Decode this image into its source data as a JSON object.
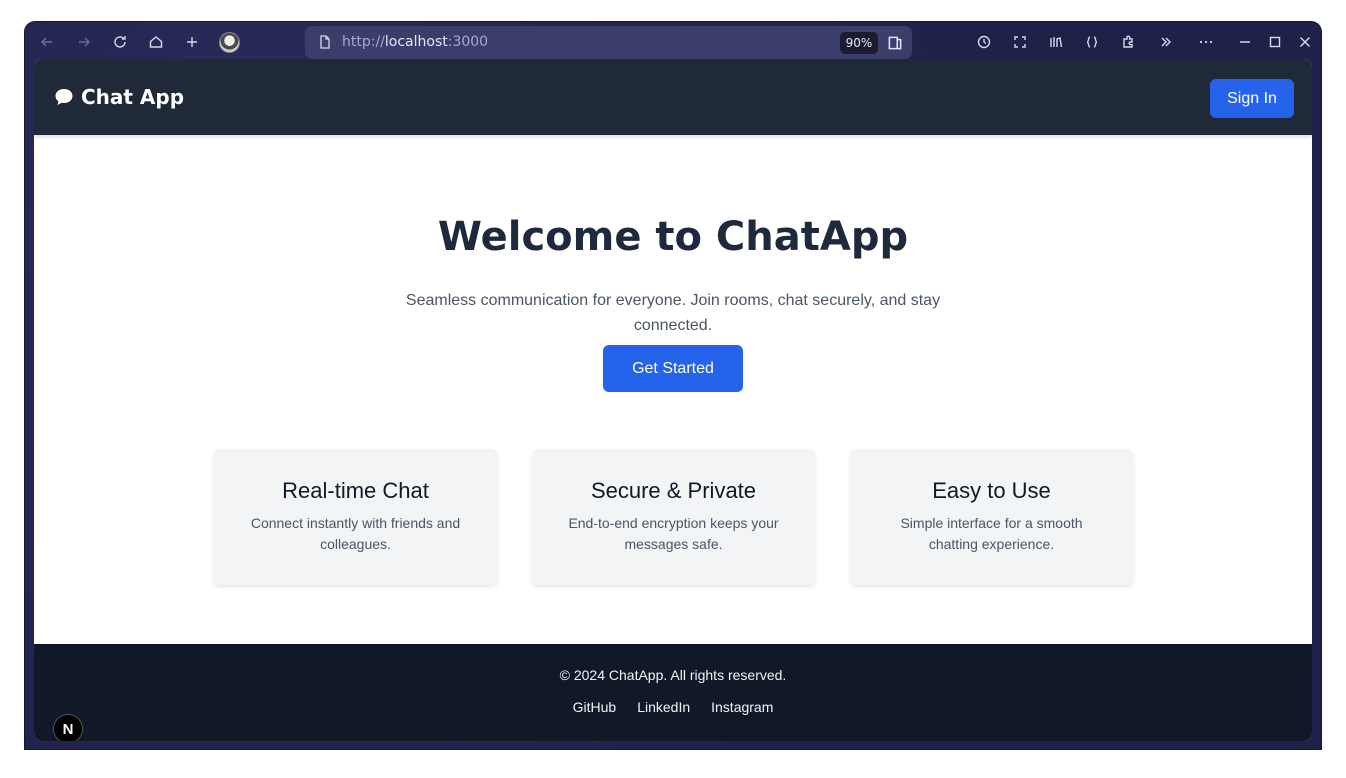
{
  "browser": {
    "url_scheme": "http://",
    "url_host": "localhost",
    "url_port": ":3000",
    "zoom": "90%",
    "toolbar_icons": [
      "back-icon",
      "forward-icon",
      "reload-icon",
      "home-icon",
      "new-tab-icon",
      "profile-avatar",
      "history-icon",
      "screenshot-icon",
      "library-icon",
      "devtools-icon",
      "extensions-icon",
      "overflow-chevron-icon",
      "menu-icon",
      "minimize-icon",
      "maximize-icon",
      "close-icon"
    ]
  },
  "nav": {
    "brand": "Chat App",
    "sign_in": "Sign In"
  },
  "hero": {
    "title": "Welcome to ChatApp",
    "subtitle": "Seamless communication for everyone. Join rooms, chat securely, and stay connected.",
    "cta": "Get Started"
  },
  "features": [
    {
      "title": "Real-time Chat",
      "description": "Connect instantly with friends and colleagues."
    },
    {
      "title": "Secure & Private",
      "description": "End-to-end encryption keeps your messages safe."
    },
    {
      "title": "Easy to Use",
      "description": "Simple interface for a smooth chatting experience."
    }
  ],
  "footer": {
    "copyright": "© 2024 ChatApp. All rights reserved.",
    "links": [
      "GitHub",
      "LinkedIn",
      "Instagram"
    ]
  },
  "dev_badge": "N",
  "colors": {
    "nav_bg": "#1f2937",
    "footer_bg": "#111827",
    "accent": "#2563eb",
    "card_bg": "#f3f4f6"
  }
}
